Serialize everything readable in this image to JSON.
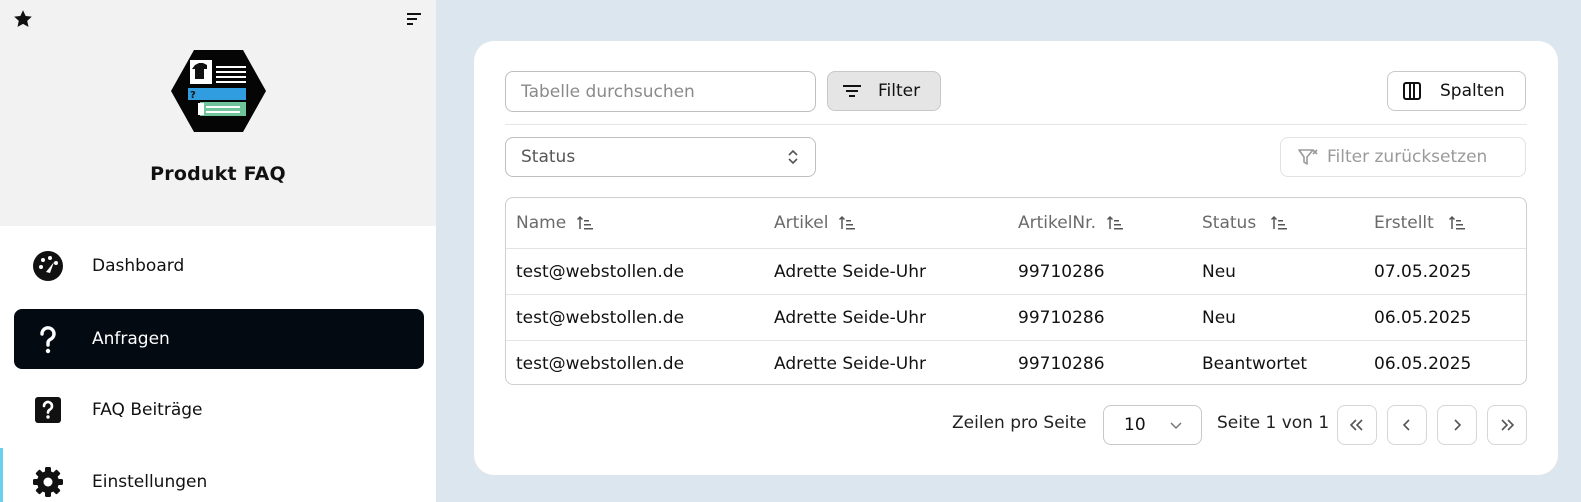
{
  "app": {
    "title": "Produkt FAQ"
  },
  "sidebar": {
    "items": [
      {
        "label": "Dashboard",
        "icon": "dashboard-gauge-icon",
        "active": false
      },
      {
        "label": "Anfragen",
        "icon": "question-mark-icon",
        "active": true
      },
      {
        "label": "FAQ Beiträge",
        "icon": "question-box-icon",
        "active": false
      },
      {
        "label": "Einstellungen",
        "icon": "gear-icon",
        "active": false
      }
    ]
  },
  "toolbar": {
    "search_placeholder": "Tabelle durchsuchen",
    "filter_label": "Filter",
    "columns_label": "Spalten",
    "status_placeholder": "Status",
    "reset_label": "Filter zurücksetzen"
  },
  "table": {
    "columns": [
      "Name",
      "Artikel",
      "ArtikelNr.",
      "Status",
      "Erstellt"
    ],
    "rows": [
      [
        "test@webstollen.de",
        "Adrette Seide-Uhr",
        "99710286",
        "Neu",
        "07.05.2025"
      ],
      [
        "test@webstollen.de",
        "Adrette Seide-Uhr",
        "99710286",
        "Neu",
        "06.05.2025"
      ],
      [
        "test@webstollen.de",
        "Adrette Seide-Uhr",
        "99710286",
        "Beantwortet",
        "06.05.2025"
      ]
    ]
  },
  "pagination": {
    "rows_per_page_label": "Zeilen pro Seite",
    "rows_per_page_value": "10",
    "page_info": "Seite 1 von 1"
  },
  "colors": {
    "accent": "#6ad0f0",
    "active_nav": "#040a12",
    "background": "#dbe6ee"
  }
}
